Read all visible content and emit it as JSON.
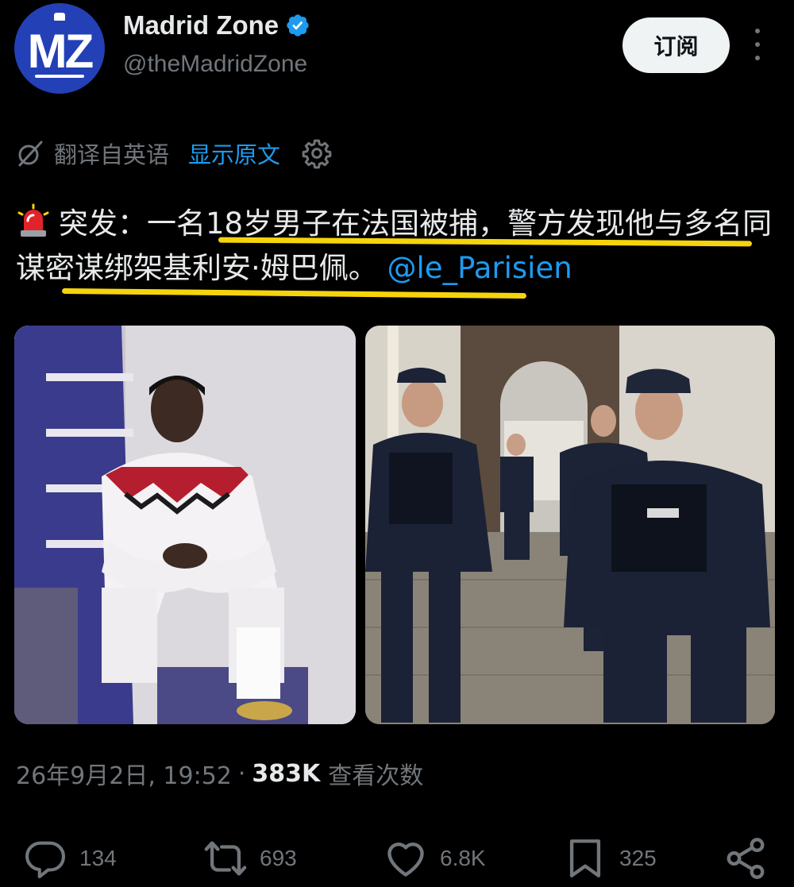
{
  "author": {
    "avatar_text": "MZ",
    "display_name": "Madrid Zone",
    "handle": "@theMadridZone",
    "verified": true,
    "avatar_color": "#2340b6",
    "verified_color": "#1d9bf0"
  },
  "header": {
    "subscribe_label": "订阅",
    "more_icon": "more-vertical-icon"
  },
  "translation": {
    "label": "翻译自英语",
    "show_original": "显示原文",
    "icon": "translate-icon",
    "settings_icon": "gear-icon"
  },
  "tweet": {
    "emoji": "siren-icon",
    "text": "突发：一名18岁男子在法国被捕，警方发现他与多名同谋密谋绑架基利安·姆巴佩。",
    "mention": "@le_Parisien",
    "highlight_color": "#f6d40b"
  },
  "media": [
    {
      "description": "photo-player-white-jacket"
    },
    {
      "description": "photo-police-officers"
    }
  ],
  "meta": {
    "timestamp": "26年9月2日, 19:52",
    "separator": "·",
    "views_count": "383K",
    "views_label": "查看次数"
  },
  "actions": {
    "replies": "134",
    "reposts": "693",
    "likes": "6.8K",
    "bookmarks": "325"
  },
  "colors": {
    "background": "#000000",
    "text": "#e7e9ea",
    "secondary": "#71767b",
    "link": "#1d9bf0"
  }
}
